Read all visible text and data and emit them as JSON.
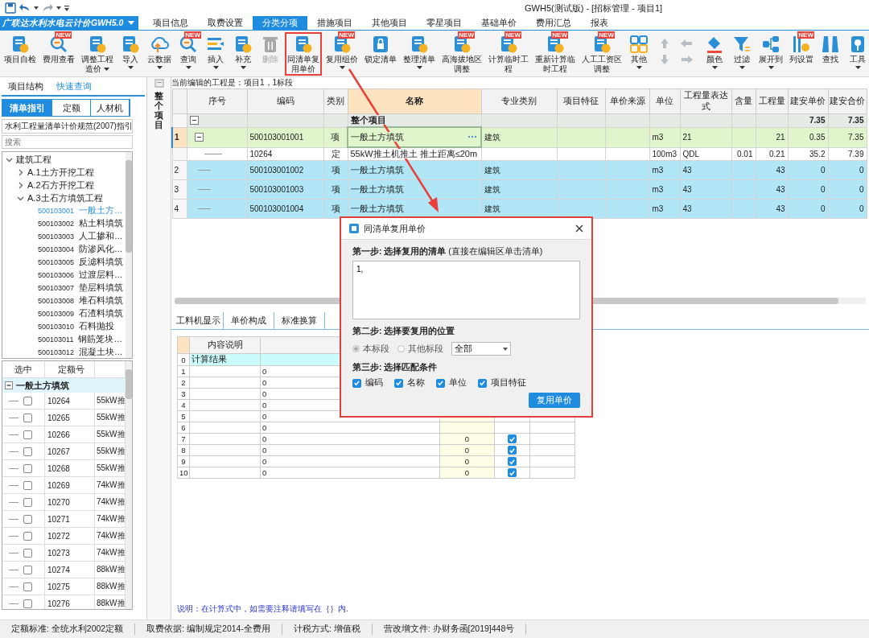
{
  "title_bar": {
    "title": "GWH5(测试版) - [招标管理 - 项目1]"
  },
  "app_menu": {
    "label": "广联达水利水电云计价GWH5.0"
  },
  "menu_tabs": [
    {
      "label": "项目信息",
      "selected": false
    },
    {
      "label": "取费设置",
      "selected": false
    },
    {
      "label": "分类分项",
      "selected": true
    },
    {
      "label": "措施项目",
      "selected": false
    },
    {
      "label": "其他项目",
      "selected": false
    },
    {
      "label": "零星项目",
      "selected": false
    },
    {
      "label": "基础单价",
      "selected": false
    },
    {
      "label": "费用汇总",
      "selected": false
    },
    {
      "label": "报表",
      "selected": false
    }
  ],
  "ribbon": [
    {
      "kind": "button",
      "lines": [
        "项目自检"
      ],
      "caret": false,
      "disabled": false,
      "highlighted": false
    },
    {
      "kind": "button",
      "lines": [
        "费用查看"
      ],
      "badge": "NEW",
      "caret": false,
      "disabled": false,
      "highlighted": false
    },
    {
      "kind": "button",
      "lines": [
        "调整工程",
        "造价"
      ],
      "caret": true,
      "disabled": false,
      "highlighted": false
    },
    {
      "kind": "button",
      "lines": [
        "导入"
      ],
      "caret": true,
      "disabled": false,
      "highlighted": false
    },
    {
      "kind": "button",
      "lines": [
        "云数据"
      ],
      "caret": true,
      "disabled": false,
      "highlighted": false
    },
    {
      "kind": "button",
      "lines": [
        "查询"
      ],
      "badge": "NEW",
      "caret": true,
      "disabled": false,
      "highlighted": false
    },
    {
      "kind": "button",
      "lines": [
        "插入"
      ],
      "caret": true,
      "disabled": false,
      "highlighted": false
    },
    {
      "kind": "button",
      "lines": [
        "补充"
      ],
      "caret": true,
      "disabled": false,
      "highlighted": false
    },
    {
      "kind": "button",
      "lines": [
        "删除"
      ],
      "caret": false,
      "disabled": true,
      "highlighted": false
    },
    {
      "kind": "button",
      "lines": [
        "同清单复",
        "用单价"
      ],
      "caret": false,
      "disabled": false,
      "highlighted": true
    },
    {
      "kind": "button",
      "lines": [
        "复用组价"
      ],
      "badge": "NEW",
      "caret": true,
      "disabled": false,
      "highlighted": false
    },
    {
      "kind": "button",
      "lines": [
        "锁定清单"
      ],
      "caret": false,
      "disabled": false,
      "highlighted": false
    },
    {
      "kind": "button",
      "lines": [
        "整理清单"
      ],
      "caret": true,
      "disabled": false,
      "highlighted": false
    },
    {
      "kind": "button",
      "lines": [
        "高海拔地区",
        "调整"
      ],
      "badge": "NEW",
      "caret": false,
      "disabled": false,
      "highlighted": false
    },
    {
      "kind": "button",
      "lines": [
        "计算临时工",
        "程"
      ],
      "badge": "NEW",
      "caret": false,
      "disabled": false,
      "highlighted": false
    },
    {
      "kind": "button",
      "lines": [
        "重新计算临",
        "时工程"
      ],
      "badge": "NEW",
      "caret": false,
      "disabled": false,
      "highlighted": false
    },
    {
      "kind": "button",
      "lines": [
        "人工工资区",
        "调整"
      ],
      "badge": "NEW",
      "caret": false,
      "disabled": false,
      "highlighted": false
    },
    {
      "kind": "button",
      "lines": [
        "其他"
      ],
      "caret": true,
      "disabled": false,
      "highlighted": false
    },
    {
      "kind": "arrows"
    },
    {
      "kind": "button",
      "lines": [
        "颜色"
      ],
      "caret": true,
      "disabled": false,
      "highlighted": false
    },
    {
      "kind": "button",
      "lines": [
        "过滤"
      ],
      "caret": true,
      "disabled": false,
      "highlighted": false
    },
    {
      "kind": "button",
      "lines": [
        "展开到"
      ],
      "caret": true,
      "disabled": false,
      "highlighted": false
    },
    {
      "kind": "button",
      "lines": [
        "列设置"
      ],
      "badge": "NEW",
      "caret": false,
      "disabled": false,
      "highlighted": false
    },
    {
      "kind": "button",
      "lines": [
        "查找"
      ],
      "caret": false,
      "disabled": false,
      "highlighted": false
    },
    {
      "kind": "button",
      "lines": [
        "工具"
      ],
      "caret": true,
      "disabled": false,
      "highlighted": false
    }
  ],
  "left_panel": {
    "tabs": [
      {
        "label": "项目结构",
        "selected": false
      },
      {
        "label": "快速查询",
        "selected": true
      }
    ],
    "sub_tabs": [
      {
        "label": "清单指引",
        "selected": true
      },
      {
        "label": "定额",
        "selected": false
      },
      {
        "label": "人材机",
        "selected": false
      }
    ],
    "guide_select": "水利工程量清单计价规范(2007)指引",
    "search": {
      "placeholder": "搜索"
    },
    "tree": [
      {
        "label": "建筑工程",
        "expanded": true,
        "children": [
          {
            "label": "A.1土方开挖工程",
            "expanded": false
          },
          {
            "label": "A.2石方开挖工程",
            "expanded": false
          },
          {
            "label": "A.3土石方填筑工程",
            "expanded": true,
            "children": [
              {
                "code": "500103001",
                "label": "一般土方…",
                "selected": true
              },
              {
                "code": "500103002",
                "label": "粘土料填筑",
                "selected": false
              },
              {
                "code": "500103003",
                "label": "人工掺和…",
                "selected": false
              },
              {
                "code": "500103004",
                "label": "防渗风化…",
                "selected": false
              },
              {
                "code": "500103005",
                "label": "反滤料填筑",
                "selected": false
              },
              {
                "code": "500103006",
                "label": "过渡层料…",
                "selected": false
              },
              {
                "code": "500103007",
                "label": "垫层料填筑",
                "selected": false
              },
              {
                "code": "500103008",
                "label": "堆石料填筑",
                "selected": false
              },
              {
                "code": "500103009",
                "label": "石渣料填筑",
                "selected": false
              },
              {
                "code": "500103010",
                "label": "石料抛投",
                "selected": false
              },
              {
                "code": "500103011",
                "label": "钢筋笼块…",
                "selected": false
              },
              {
                "code": "500103012",
                "label": "混凝土块…",
                "selected": false
              }
            ]
          }
        ]
      }
    ],
    "quota_grid": {
      "columns": [
        "选中",
        "定额号"
      ],
      "group": {
        "label": "一般土方填筑",
        "expanded": true
      },
      "rows": [
        {
          "checked": false,
          "code": "10264",
          "name": "55kW推"
        },
        {
          "checked": false,
          "code": "10265",
          "name": "55kW推"
        },
        {
          "checked": false,
          "code": "10266",
          "name": "55kW推"
        },
        {
          "checked": false,
          "code": "10267",
          "name": "55kW推"
        },
        {
          "checked": false,
          "code": "10268",
          "name": "55kW推"
        },
        {
          "checked": false,
          "code": "10269",
          "name": "74kW推"
        },
        {
          "checked": false,
          "code": "10270",
          "name": "74kW推"
        },
        {
          "checked": false,
          "code": "10271",
          "name": "74kW推"
        },
        {
          "checked": false,
          "code": "10272",
          "name": "74kW推"
        },
        {
          "checked": false,
          "code": "10273",
          "name": "74kW推"
        },
        {
          "checked": false,
          "code": "10274",
          "name": "88kW推"
        },
        {
          "checked": false,
          "code": "10275",
          "name": "88kW推"
        },
        {
          "checked": false,
          "code": "10276",
          "name": "88kW推"
        }
      ]
    }
  },
  "side_strip": {
    "title": "整个项目"
  },
  "main": {
    "caption": "当前编辑的工程是：项目1，1标段",
    "columns": [
      {
        "label": "序号",
        "active": false
      },
      {
        "label": "编码",
        "active": false
      },
      {
        "label": "类别",
        "active": false
      },
      {
        "label": "名称",
        "active": true
      },
      {
        "label": "专业类别",
        "active": false
      },
      {
        "label": "项目特征",
        "active": false
      },
      {
        "label": "单价来源",
        "active": false
      },
      {
        "label": "单位",
        "active": false
      },
      {
        "label": "工程量表达式",
        "active": false
      },
      {
        "label": "含量",
        "active": false
      },
      {
        "label": "工程量",
        "active": false
      },
      {
        "label": "建安单价",
        "active": false
      },
      {
        "label": "建安合价",
        "active": false
      }
    ],
    "rows": [
      {
        "kind": "group",
        "focused": false,
        "selected": false,
        "expanded": true,
        "name": "整个项目",
        "price": "7.35",
        "total": "7.35"
      },
      {
        "kind": "item",
        "focused": true,
        "selected": false,
        "expanded": true,
        "no": "1",
        "code": "500103001001",
        "type": "项",
        "name": "一般土方填筑",
        "specialty": "建筑",
        "unit": "m3",
        "expr": "21",
        "qty": "21",
        "price": "0.35",
        "total": "7.35"
      },
      {
        "kind": "quota",
        "focused": false,
        "selected": false,
        "code": "10264",
        "type": "定",
        "name": "55kW推土机推土 推土距离≤20m",
        "unit": "100m3",
        "expr": "QDL",
        "content": "0.01",
        "qty": "0.21",
        "price": "35.2",
        "total": "7.39"
      },
      {
        "kind": "item",
        "focused": false,
        "selected": true,
        "no": "2",
        "code": "500103001002",
        "type": "项",
        "name": "一般土方填筑",
        "specialty": "建筑",
        "unit": "m3",
        "expr": "43",
        "qty": "43",
        "price": "0",
        "total": "0"
      },
      {
        "kind": "item",
        "focused": false,
        "selected": true,
        "no": "3",
        "code": "500103001003",
        "type": "项",
        "name": "一般土方填筑",
        "specialty": "建筑",
        "unit": "m3",
        "expr": "43",
        "qty": "43",
        "price": "0",
        "total": "0"
      },
      {
        "kind": "item",
        "focused": false,
        "selected": true,
        "no": "4",
        "code": "500103001004",
        "type": "项",
        "name": "一般土方填筑",
        "specialty": "建筑",
        "unit": "m3",
        "expr": "43",
        "qty": "43",
        "price": "0",
        "total": "0"
      }
    ],
    "detail_tabs": [
      {
        "label": "工料机显示",
        "selected": false
      },
      {
        "label": "单价构成",
        "selected": false
      },
      {
        "label": "标准换算",
        "selected": false
      }
    ],
    "detail_grid": {
      "columns": [
        "内容说明"
      ],
      "rows": [
        {
          "kind": "result",
          "no": "0",
          "desc": "计算结果"
        },
        {
          "kind": "line",
          "no": "1",
          "formula": "0"
        },
        {
          "kind": "line",
          "no": "2",
          "formula": "0"
        },
        {
          "kind": "line",
          "no": "3",
          "formula": "0"
        },
        {
          "kind": "line",
          "no": "4",
          "formula": "0"
        },
        {
          "kind": "line",
          "no": "5",
          "formula": "0"
        },
        {
          "kind": "line",
          "no": "6",
          "formula": "0"
        },
        {
          "kind": "line",
          "no": "7",
          "formula": "0",
          "amount": "0",
          "checked": true
        },
        {
          "kind": "line",
          "no": "8",
          "formula": "0",
          "amount": "0",
          "checked": true
        },
        {
          "kind": "line",
          "no": "9",
          "formula": "0",
          "amount": "0",
          "checked": true
        },
        {
          "kind": "line",
          "no": "10",
          "formula": "0",
          "amount": "0",
          "checked": true
        }
      ]
    },
    "note": "说明：在计算式中，如需要注释请填写在｛｝内."
  },
  "dialog": {
    "title": "同清单复用单价",
    "step1": "**第一步: 选择复用的清单** (直接在编辑区单击清单)",
    "list_value": "1,",
    "step2": "第二步: 选择要复用的位置",
    "positions": [
      {
        "label": "本标段",
        "selected": true
      },
      {
        "label": "其他标段",
        "selected": false
      }
    ],
    "scope_select": "全部",
    "step3": "第三步: 选择匹配条件",
    "conditions": [
      {
        "label": "编码",
        "checked": true
      },
      {
        "label": "名称",
        "checked": true
      },
      {
        "label": "单位",
        "checked": true
      },
      {
        "label": "项目特征",
        "checked": true
      }
    ],
    "button": "复用单价"
  },
  "status_bar": [
    "定额标准: 全统水利2002定额",
    "取费依据: 编制规定2014-全费用",
    "计税方式: 增值税",
    "营改增文件: 办财务函[2019]448号"
  ]
}
